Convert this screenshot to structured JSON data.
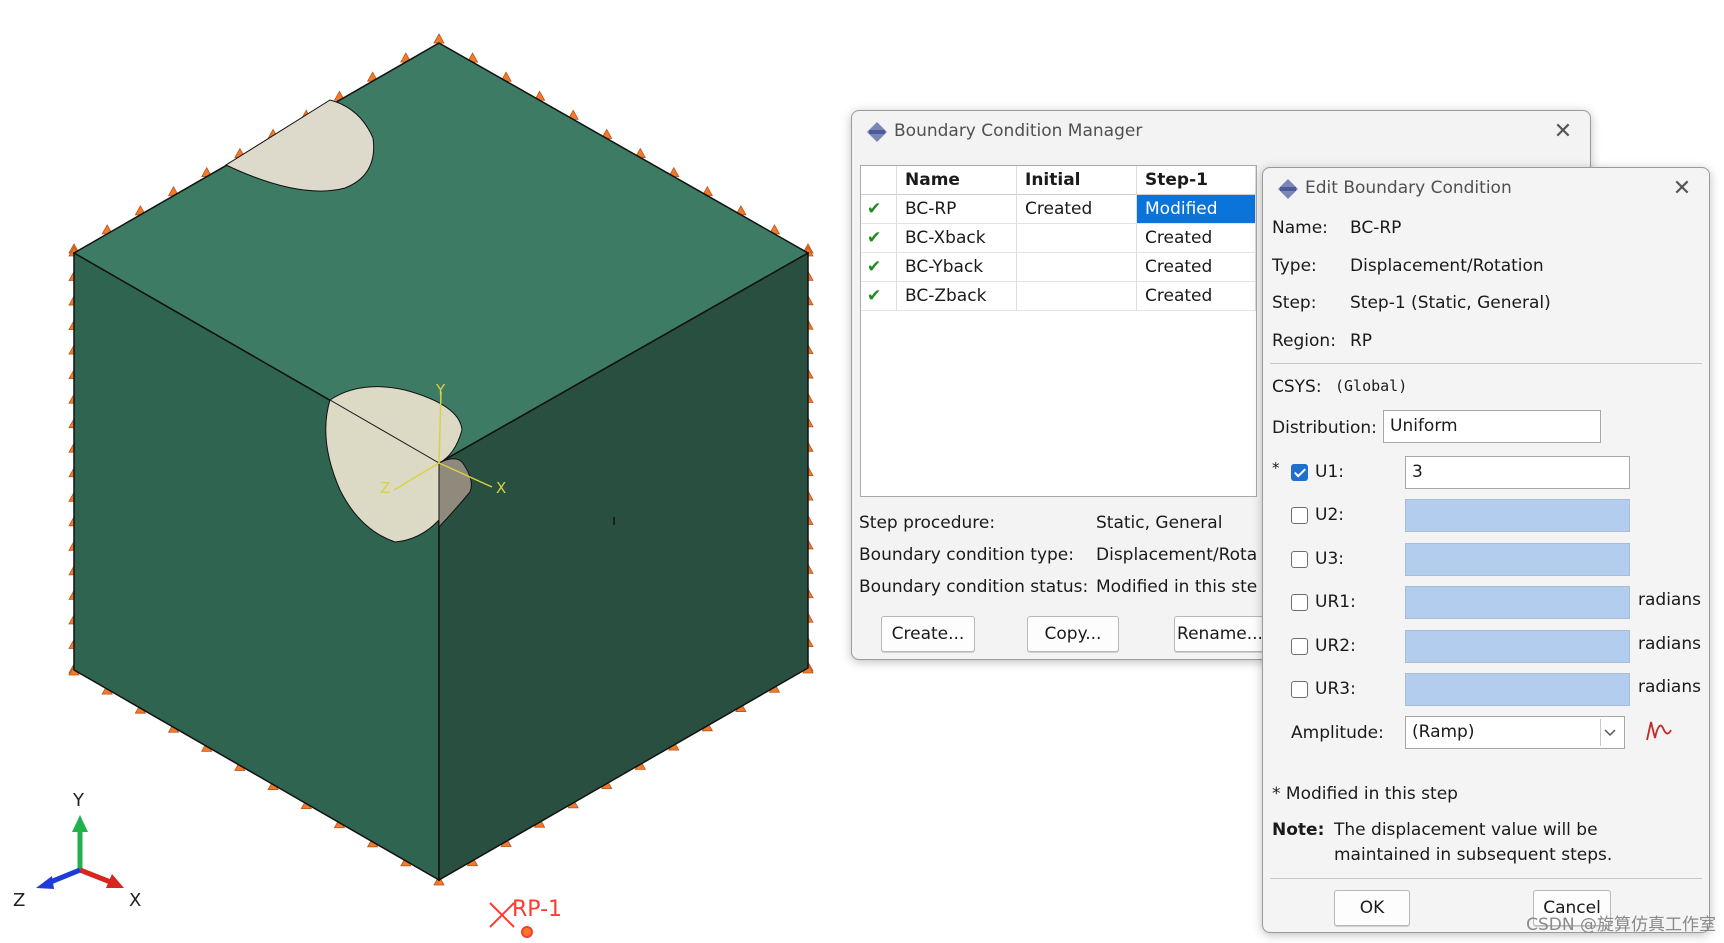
{
  "viewport": {
    "triad_labels": {
      "y": "Y",
      "z": "Z",
      "x": "X"
    },
    "part_csys_labels": {
      "y": "Y",
      "z": "Z",
      "x": "X"
    },
    "rp_label": "RP-1",
    "colors": {
      "cube_top": "#3e7b65",
      "cube_left": "#2f6450",
      "cube_right": "#284f40",
      "bc_marker": "#f27a2a",
      "rp": "#ff3b30"
    }
  },
  "manager": {
    "title": "Boundary Condition Manager",
    "columns": [
      "Name",
      "Initial",
      "Step-1"
    ],
    "rows": [
      {
        "name": "BC-RP",
        "initial": "Created",
        "step": "Modified",
        "check": "✔"
      },
      {
        "name": "BC-Xback",
        "initial": "",
        "step": "Created",
        "check": "✔"
      },
      {
        "name": "BC-Yback",
        "initial": "",
        "step": "Created",
        "check": "✔"
      },
      {
        "name": "BC-Zback",
        "initial": "",
        "step": "Created",
        "check": "✔"
      }
    ],
    "info": {
      "procedure_label": "Step procedure:",
      "procedure_value": "Static, General",
      "type_label": "Boundary condition type:",
      "type_value": "Displacement/Rota",
      "status_label": "Boundary condition status:",
      "status_value": "Modified in this ste"
    },
    "buttons": {
      "create": "Create...",
      "copy": "Copy...",
      "rename": "Rename..."
    },
    "close": "✕"
  },
  "edit": {
    "title": "Edit Boundary Condition",
    "close": "✕",
    "name_label": "Name:",
    "name_value": "BC-RP",
    "type_label": "Type:",
    "type_value": "Displacement/Rotation",
    "step_label": "Step:",
    "step_value": "Step-1 (Static, General)",
    "region_label": "Region:",
    "region_value": "RP",
    "csys_label": "CSYS:",
    "csys_value": "(Global)",
    "distribution_label": "Distribution:",
    "distribution_value": "Uniform",
    "asterisk": "*",
    "dofs": [
      {
        "label": "U1:",
        "checked": true,
        "value": "3",
        "unit": ""
      },
      {
        "label": "U2:",
        "checked": false,
        "value": "",
        "unit": ""
      },
      {
        "label": "U3:",
        "checked": false,
        "value": "",
        "unit": ""
      },
      {
        "label": "UR1:",
        "checked": false,
        "value": "",
        "unit": "radians"
      },
      {
        "label": "UR2:",
        "checked": false,
        "value": "",
        "unit": "radians"
      },
      {
        "label": "UR3:",
        "checked": false,
        "value": "",
        "unit": "radians"
      }
    ],
    "amplitude_label": "Amplitude:",
    "amplitude_value": "(Ramp)",
    "modified_note": "* Modified in this step",
    "note_label": "Note:",
    "note_line1": "The displacement value will be",
    "note_line2": "maintained in subsequent steps.",
    "ok": "OK",
    "cancel": "Cancel"
  },
  "watermark": "CSDN @旋算仿真工作室"
}
